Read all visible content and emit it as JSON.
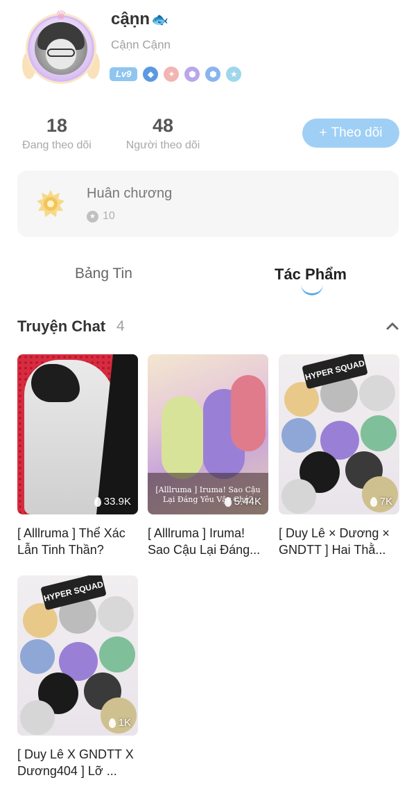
{
  "profile": {
    "name": "cậṇn",
    "name_emoji": "🐟",
    "handle": "Cậṇn Cậṇn",
    "level": "Lv9",
    "badges": [
      "diamond-badge",
      "shield-badge",
      "hex-badge-purple",
      "hex-badge-blue",
      "star-badge"
    ]
  },
  "stats": {
    "following_count": "18",
    "following_label": "Đang theo dõi",
    "followers_count": "48",
    "followers_label": "Người theo dõi"
  },
  "follow_button": {
    "label": "Theo dõi",
    "icon": "+"
  },
  "medals": {
    "title": "Huân chương",
    "count": "10"
  },
  "tabs": [
    {
      "label": "Bảng Tin",
      "active": false
    },
    {
      "label": "Tác Phẩm",
      "active": true
    }
  ],
  "section": {
    "title": "Truyện Chat",
    "count": "4"
  },
  "stories": [
    {
      "title": "[ Alllruma ] Thể Xác Lẫn Tinh Thần?",
      "views": "33.9K",
      "cover_text": ""
    },
    {
      "title": "[ Alllruma ] Iruma! Sao Cậu Lại Đáng...",
      "views": "5.44K",
      "cover_text": "[Alllruma ] Iruma! Sao Cậu Lại Đáng Yêu Vậy Chứ?"
    },
    {
      "title": "[ Duy Lê × Dương × GNDTT ] Hai Thằ...",
      "views": "7K",
      "cover_text": "HYPER SQUAD"
    },
    {
      "title": "[ Duy Lê X GNDTT X Dương404 ] Lỡ ...",
      "views": "1K",
      "cover_text": "HYPER SQUAD"
    }
  ],
  "colors": {
    "accent": "#5aa9e6",
    "follow_button": "#9fcff5",
    "level_badge": "#8fc6f0"
  }
}
